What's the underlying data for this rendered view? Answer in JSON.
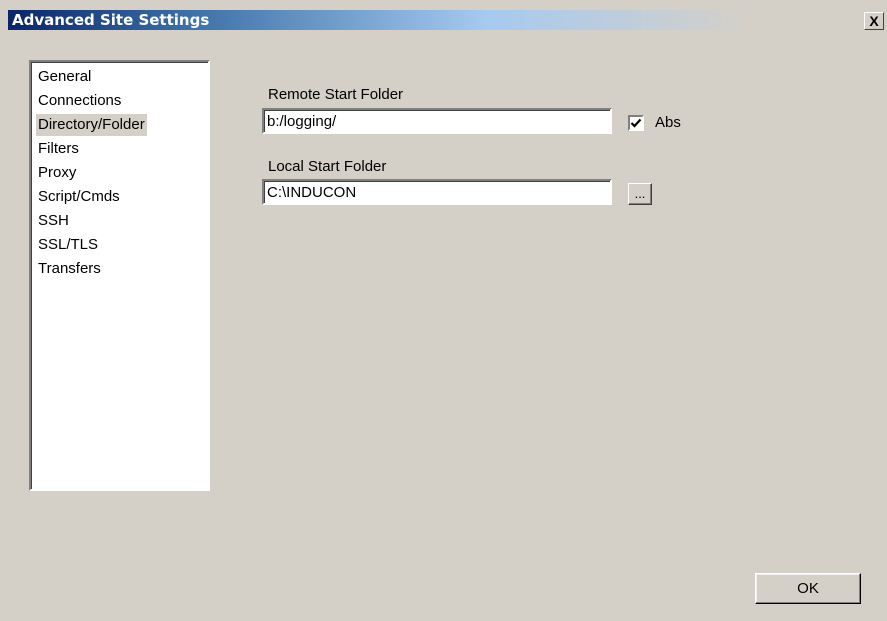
{
  "window": {
    "title": "Advanced Site Settings",
    "close_glyph": "X"
  },
  "nav": {
    "items": [
      {
        "label": "General"
      },
      {
        "label": "Connections"
      },
      {
        "label": "Directory/Folder",
        "selected": true
      },
      {
        "label": "Filters"
      },
      {
        "label": "Proxy"
      },
      {
        "label": "Script/Cmds"
      },
      {
        "label": "SSH"
      },
      {
        "label": "SSL/TLS"
      },
      {
        "label": "Transfers"
      }
    ]
  },
  "remote": {
    "label": "Remote Start Folder",
    "value": "b:/logging/",
    "abs_label": "Abs",
    "abs_checked": true
  },
  "local": {
    "label": "Local Start Folder",
    "value": "C:\\INDUCON",
    "browse_label": "..."
  },
  "footer": {
    "ok_label": "OK"
  },
  "colors": {
    "face": "#d4d0c8",
    "title_active": "#0a246a",
    "selection": "#d4d0c8"
  }
}
